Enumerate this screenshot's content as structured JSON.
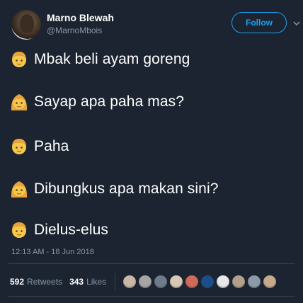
{
  "author": {
    "name": "Marno Blewah",
    "handle": "@MarnoMbois"
  },
  "follow_label": "Follow",
  "lines": [
    {
      "icon": "boy-emoji-icon",
      "text": "Mbak beli ayam goreng"
    },
    {
      "icon": "girl-emoji-icon",
      "text": "Sayap apa paha mas?"
    },
    {
      "icon": "boy-emoji-icon",
      "text": "Paha"
    },
    {
      "icon": "girl-emoji-icon",
      "text": "Dibungkus apa makan sini?"
    },
    {
      "icon": "boy-emoji-icon",
      "text": "Dielus-elus"
    }
  ],
  "timestamp": "12:13 AM - 18 Jun 2018",
  "stats": {
    "retweets_count": "592",
    "retweets_label": "Retweets",
    "likes_count": "343",
    "likes_label": "Likes"
  },
  "liker_avatars": [
    "#c9b7a6",
    "#a5a5a5",
    "#6e7b8a",
    "#d8c8b5",
    "#d06a5a",
    "#1c4f8a",
    "#e8e8e8",
    "#b3a08a",
    "#8a9aa8",
    "#c7a98e"
  ],
  "colors": {
    "background": "#1b2430",
    "accent": "#1da1f2",
    "muted_text": "#8899a6"
  }
}
